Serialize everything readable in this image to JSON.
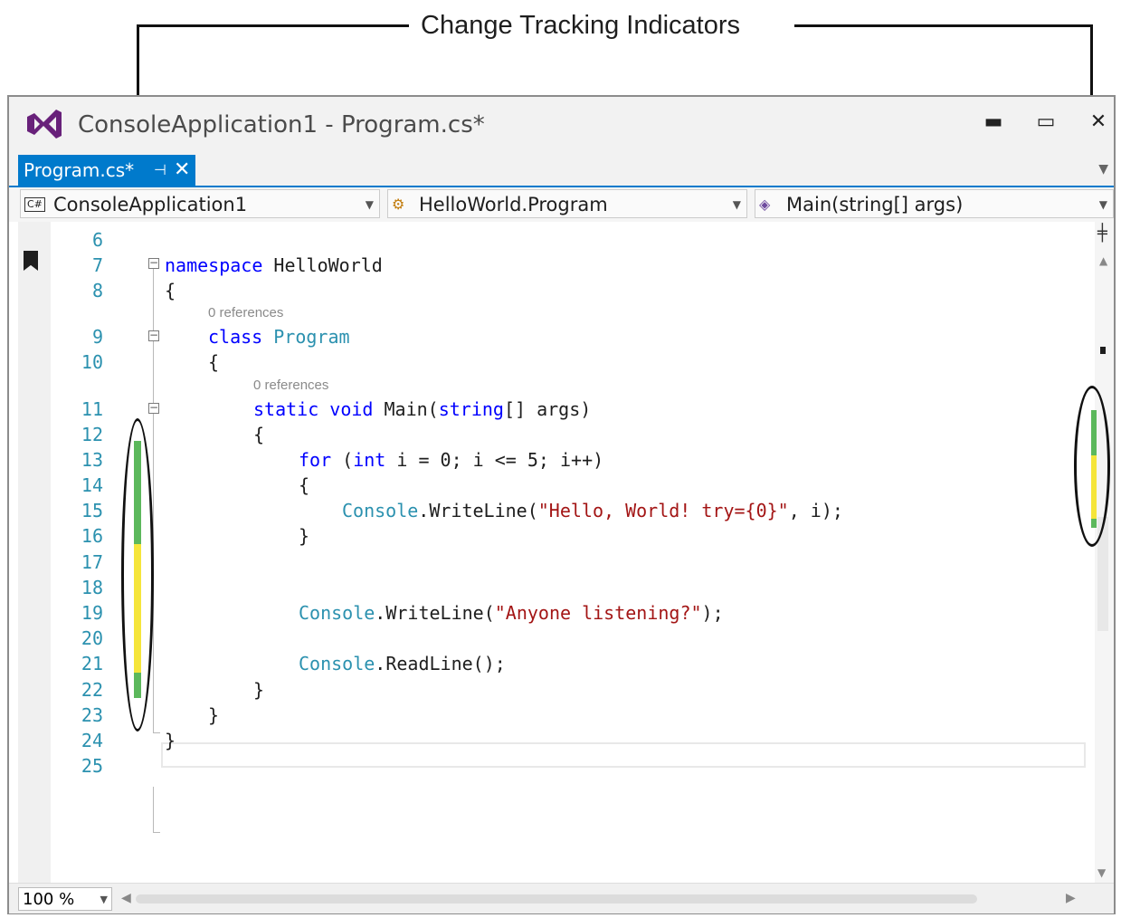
{
  "callout": {
    "title": "Change Tracking Indicators"
  },
  "window": {
    "title": "ConsoleApplication1 - Program.cs*",
    "minimize_glyph": "▬",
    "maximize_glyph": "▭",
    "close_glyph": "✕"
  },
  "tab": {
    "label": "Program.cs*",
    "pin_glyph": "⊣",
    "close_glyph": "✕",
    "overflow_glyph": "▼"
  },
  "navbar": {
    "project": "ConsoleApplication1",
    "class": "HelloWorld.Program",
    "member": "Main(string[] args)",
    "project_icon": "csharp-project-icon",
    "class_icon": "class-icon",
    "member_icon": "method-icon"
  },
  "editor": {
    "line_numbers": [
      "6",
      "7",
      "8",
      "9",
      "10",
      "11",
      "12",
      "13",
      "14",
      "15",
      "16",
      "17",
      "18",
      "19",
      "20",
      "21",
      "22",
      "23",
      "24",
      "25"
    ],
    "code_lens": [
      "0 references",
      "0 references"
    ],
    "code": {
      "l7_kw": "namespace",
      "l7_name": " HelloWorld",
      "brace_open": "{",
      "brace_close": "}",
      "l9_kw": "class",
      "l9_name": " Program",
      "l11_kw1": "static",
      "l11_kw2": " void",
      "l11_method": " Main(",
      "l11_type": "string",
      "l11_rest": "[] args)",
      "l13_for": "for",
      "l13_open": " (",
      "l13_int": "int",
      "l13_rest": " i = 0; i <= 5; i++)",
      "console": "Console",
      "writeline": ".WriteLine(",
      "readline": ".ReadLine();",
      "l15_str": "\"Hello, World! try={0}\"",
      "l15_rest": ", i);",
      "l19_str": "\"Anyone listening?\"",
      "l19_rest": ");"
    },
    "change_colors": {
      "saved": "#5cb85c",
      "unsaved": "#f5e53a"
    }
  },
  "statusbar": {
    "zoom": "100 %"
  }
}
